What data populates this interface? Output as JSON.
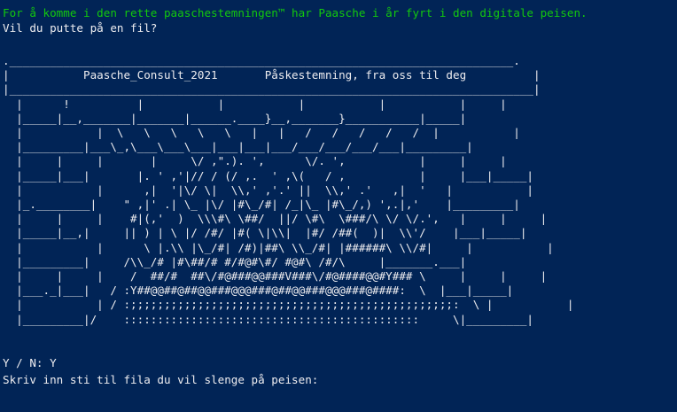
{
  "terminal": {
    "background": "#012456",
    "text_color": "#eeedf0",
    "highlight_color": "#13c80e",
    "intro_line": "For å komme i den rette paaschestemningen™ har Paasche i år fyrt i den digitale peisen.",
    "question_line": "Vil du putte på en fil?",
    "banner": {
      "left_label": "Paasche_Consult_2021",
      "right_label": "Påskestemning, fra oss til deg"
    },
    "fireplace_art": ".___________________________________________________________________________.\n|           Paasche_Consult_2021       Påskestemning, fra oss til deg          |\n|______________________________________________________________________________|\n  |      !          |           |           |           |           |     |\n  |_____|__,_______|_______|______.____}__,_______}___________|_____|\n  |           |  \\   \\   \\   \\   \\   |   |   /   /   /   /   /  |           |\n  |_________|___\\_,\\___\\___\\___|___|___|___/___/___/___/___|_________|\n  |     |     |       |     \\/ ,\".). ',      \\/. ',           |     |     |\n  |_____|___|       |. ' ,'|// / (/ ,.  ' ,\\(   / ,           |     |___|_____|\n  |           |      ,|  '|\\/ \\|  \\\\,' ,'.' ||  \\\\,' .'   ,|  '   |           |\n  |_.________|    \" ,|' .| \\_ |\\/ |#\\_/#| /_|\\_ |#\\_/,) ',.|,'    |_________|\n  |     |     |    #|(,'  )  \\\\\\#\\ \\##/  ||/ \\#\\  \\###/\\ \\/ \\/.',   |     |     |\n  |_____|__,|     || ) | \\ |/ /#/ |#( \\|\\\\|  |#/ /##(  )|  \\\\'/    |___|_____|\n  |           |      \\ |.\\\\ |\\_/#| /#)|##\\ \\\\_/#| |######\\ \\\\/#|     |           |\n  |_________|     /\\\\_/# |#\\##/# #/#@#\\#/ #@#\\ /#/\\     |_______.___|\n  |     |     |    /  ##/#  ##\\/#@###@@###V###\\/#@####@@#Y### \\     |     |     |\n  |___._|___|   / :Y##@@##@##@@###@@@###@##@@###@@@###@####:  \\  |___|_____|\n  |           | / :;;;;;;;;;;;;;;;;;;;;;;;;;;;;;;;;;;;;;;;;;;;;;;;;:  \\ |           |\n  |_________|/    ::::::::::::::::::::::::::::::::::::::::::::     \\|_________|",
    "answer_line": "Y / N: Y",
    "path_prompt": "Skriv inn sti til fila du vil slenge på peisen:"
  }
}
